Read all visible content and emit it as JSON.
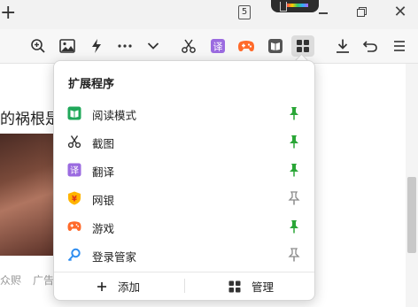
{
  "titlebar": {
    "new_tab_label": "+",
    "tab_count": "5"
  },
  "page": {
    "headline": "的祸根是饣",
    "meta_source": "众赆",
    "meta_ad": "广告"
  },
  "popup": {
    "title": "扩展程序",
    "extensions": [
      {
        "name": "阅读模式",
        "icon": "reading-mode-icon",
        "pinned": true
      },
      {
        "name": "截图",
        "icon": "scissors-icon",
        "pinned": true
      },
      {
        "name": "翻译",
        "icon": "translate-icon",
        "pinned": true
      },
      {
        "name": "网银",
        "icon": "bank-shield-icon",
        "pinned": false
      },
      {
        "name": "游戏",
        "icon": "gamepad-icon",
        "pinned": true
      },
      {
        "name": "登录管家",
        "icon": "key-icon",
        "pinned": false
      }
    ],
    "footer": {
      "add_label": "添加",
      "manage_label": "管理"
    }
  },
  "colors": {
    "pinned": "#2aa637",
    "unpinned": "#8a8a8a",
    "translate": "#9b6be0",
    "game": "#ff6a2a",
    "reading": "#20a85a"
  }
}
